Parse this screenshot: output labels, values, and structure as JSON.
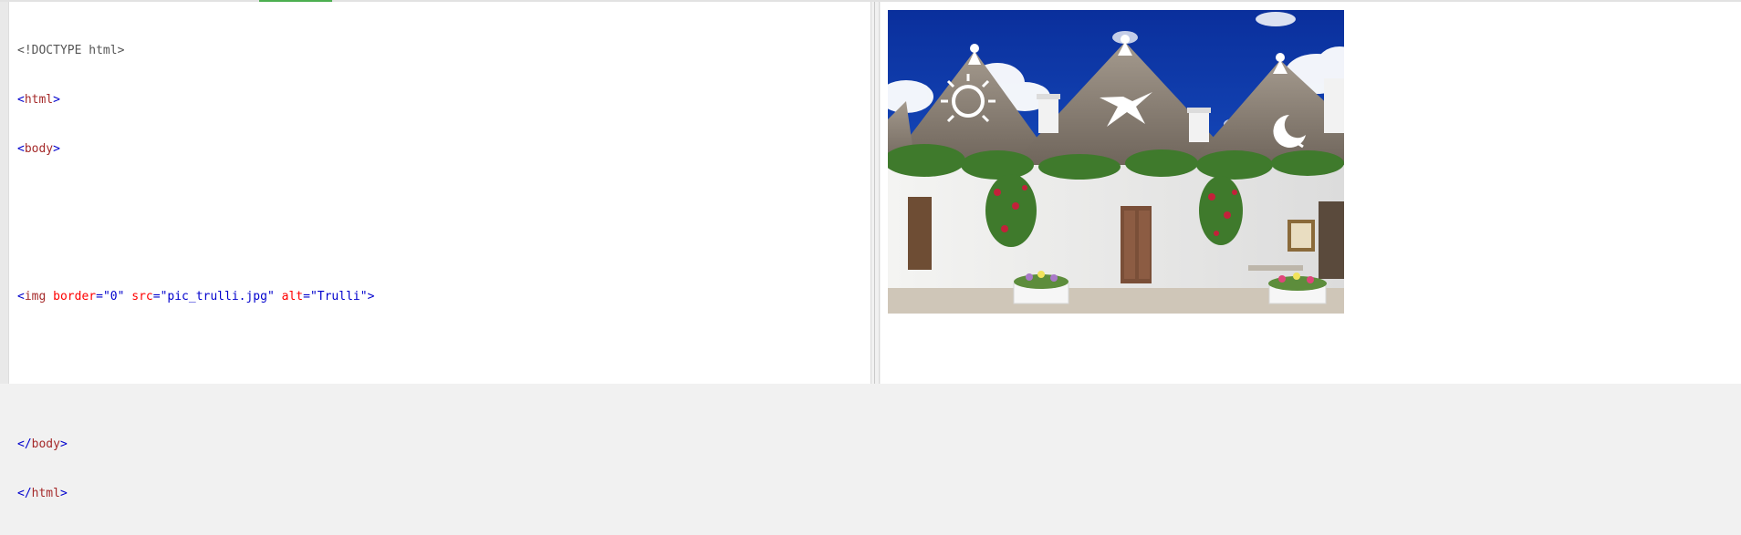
{
  "editor": {
    "lines": [
      {
        "doctype": "<!DOCTYPE html>"
      },
      {
        "open": "<",
        "tag": "html",
        "close": ">"
      },
      {
        "open": "<",
        "tag": "body",
        "close": ">"
      },
      {},
      {},
      {
        "open": "<",
        "tag": "img",
        "a1": "border",
        "eq1": "=",
        "v1": "\"0\"",
        "a2": "src",
        "eq2": "=",
        "v2": "\"pic_trulli.jpg\"",
        "a3": "alt",
        "eq3": "=",
        "v3": "\"Trulli\"",
        "close": ">"
      },
      {},
      {},
      {
        "open": "</",
        "tag": "body",
        "close": ">"
      },
      {
        "open": "</",
        "tag": "html",
        "close": ">"
      }
    ]
  },
  "preview": {
    "image_alt": "Trulli",
    "image_src_name": "pic_trulli.jpg"
  },
  "colors": {
    "tag": "#a52a2a",
    "attribute": "#ff0000",
    "value": "#0000cd",
    "accent": "#4caf50"
  }
}
